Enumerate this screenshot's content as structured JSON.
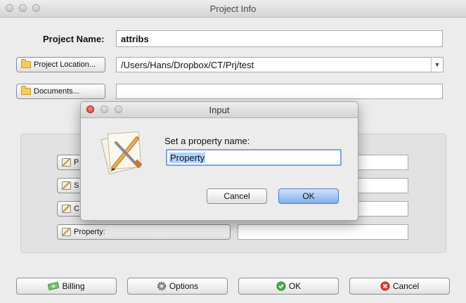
{
  "window": {
    "title": "Project Info"
  },
  "project": {
    "name_label": "Project Name:",
    "name_value": "attribs",
    "location_button": "Project Location...",
    "location_value": "/Users/Hans/Dropbox/CT/Prj/test",
    "documents_button": "Documents...",
    "documents_value": ""
  },
  "properties": {
    "rows": [
      {
        "label": "P",
        "value": ""
      },
      {
        "label": "S",
        "value": ""
      },
      {
        "label": "C",
        "value": ""
      },
      {
        "label": "Property:",
        "value": ""
      }
    ]
  },
  "footer": {
    "billing": "Billing",
    "options": "Options",
    "ok": "OK",
    "cancel": "Cancel"
  },
  "dialog": {
    "title": "Input",
    "prompt": "Set a property name:",
    "input_value": "Property",
    "cancel": "Cancel",
    "ok": "OK"
  }
}
